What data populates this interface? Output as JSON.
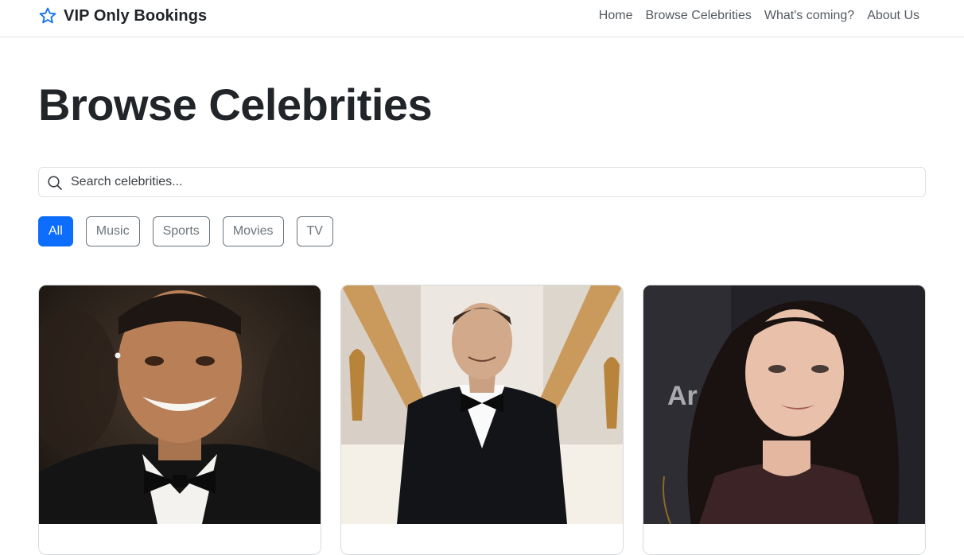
{
  "brand": {
    "name": "VIP Only Bookings",
    "icon": "star-icon",
    "color": "#0d6efd"
  },
  "nav": {
    "links": [
      {
        "label": "Home"
      },
      {
        "label": "Browse Celebrities"
      },
      {
        "label": "What's coming?"
      },
      {
        "label": "About Us"
      }
    ]
  },
  "page": {
    "title": "Browse Celebrities"
  },
  "search": {
    "placeholder": "Search celebrities...",
    "value": "",
    "icon": "search-icon"
  },
  "filters": [
    {
      "label": "All",
      "active": true
    },
    {
      "label": "Music",
      "active": false
    },
    {
      "label": "Sports",
      "active": false
    },
    {
      "label": "Movies",
      "active": false
    },
    {
      "label": "TV",
      "active": false
    }
  ],
  "colors": {
    "accent": "#0d6efd",
    "muted": "#6c757d",
    "text": "#212529"
  },
  "cards": [
    {
      "image": "celebrity-photo"
    },
    {
      "image": "celebrity-photo"
    },
    {
      "image": "celebrity-photo"
    }
  ]
}
